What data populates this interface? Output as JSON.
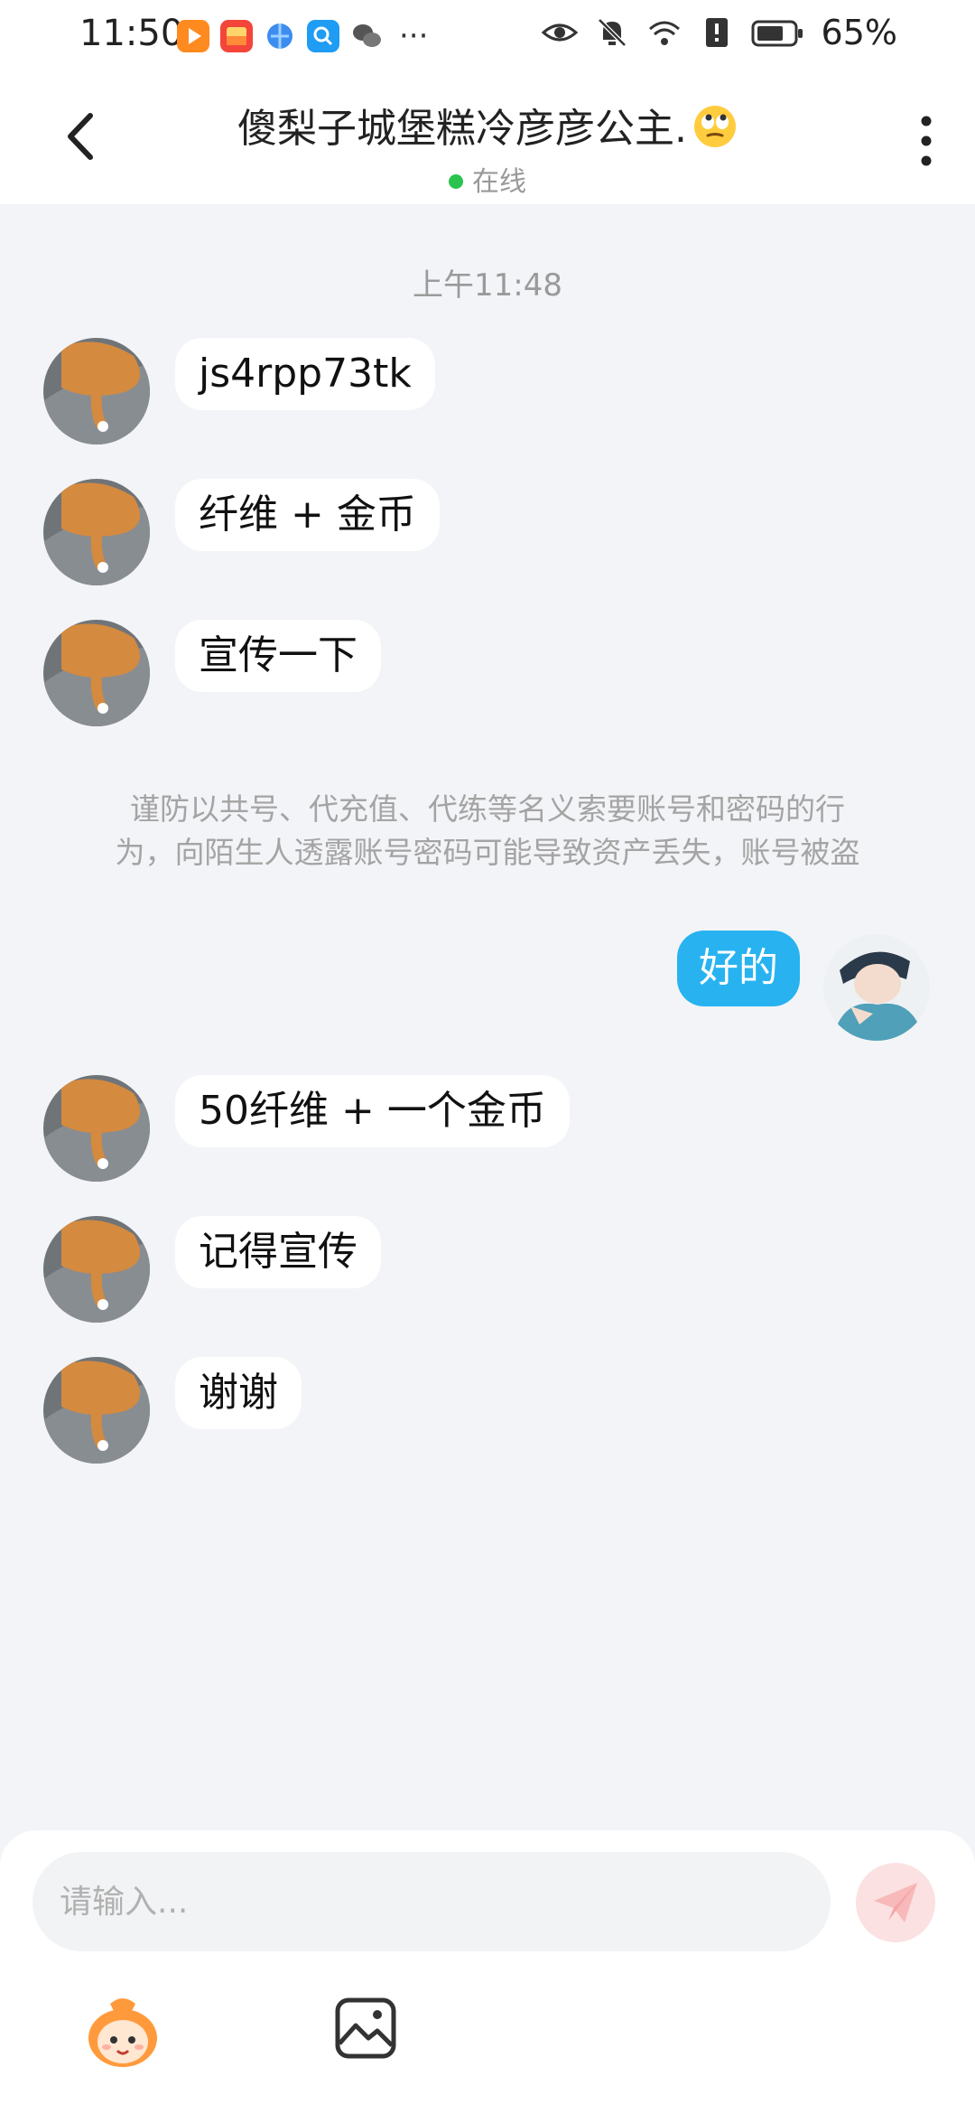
{
  "status_bar": {
    "time": "11:50",
    "battery": "65%",
    "icons": [
      "video-app-icon",
      "gallery-app-icon",
      "browser-icon",
      "search-app-icon",
      "wechat-icon",
      "more-dots",
      "eye-icon",
      "bell-off-icon",
      "wifi-icon",
      "sim-alert-icon",
      "battery-icon"
    ]
  },
  "header": {
    "title": "傻梨子城堡糕冷彦彦公主.",
    "title_emoji": "eye-roll-emoji-icon",
    "status": "在线"
  },
  "chat": {
    "timestamp": "上午11:48",
    "messages_before": [
      {
        "text": "js4rpp73tk"
      },
      {
        "text": "纤维 + 金币"
      },
      {
        "text": "宣传一下"
      }
    ],
    "notice_line1": "谨防以共号、代充值、代练等名义索要账号和密码的行",
    "notice_line2": "为，向陌生人透露账号密码可能导致资产丢失，账号被盗",
    "my_message": "好的",
    "messages_after": [
      {
        "text": "50纤维 + 一个金币"
      },
      {
        "text": "记得宣传"
      },
      {
        "text": "谢谢"
      }
    ]
  },
  "composer": {
    "placeholder": "请输入..."
  },
  "colors": {
    "accent": "#28b3f0",
    "online": "#2ac34e",
    "background": "#f3f4f7"
  }
}
